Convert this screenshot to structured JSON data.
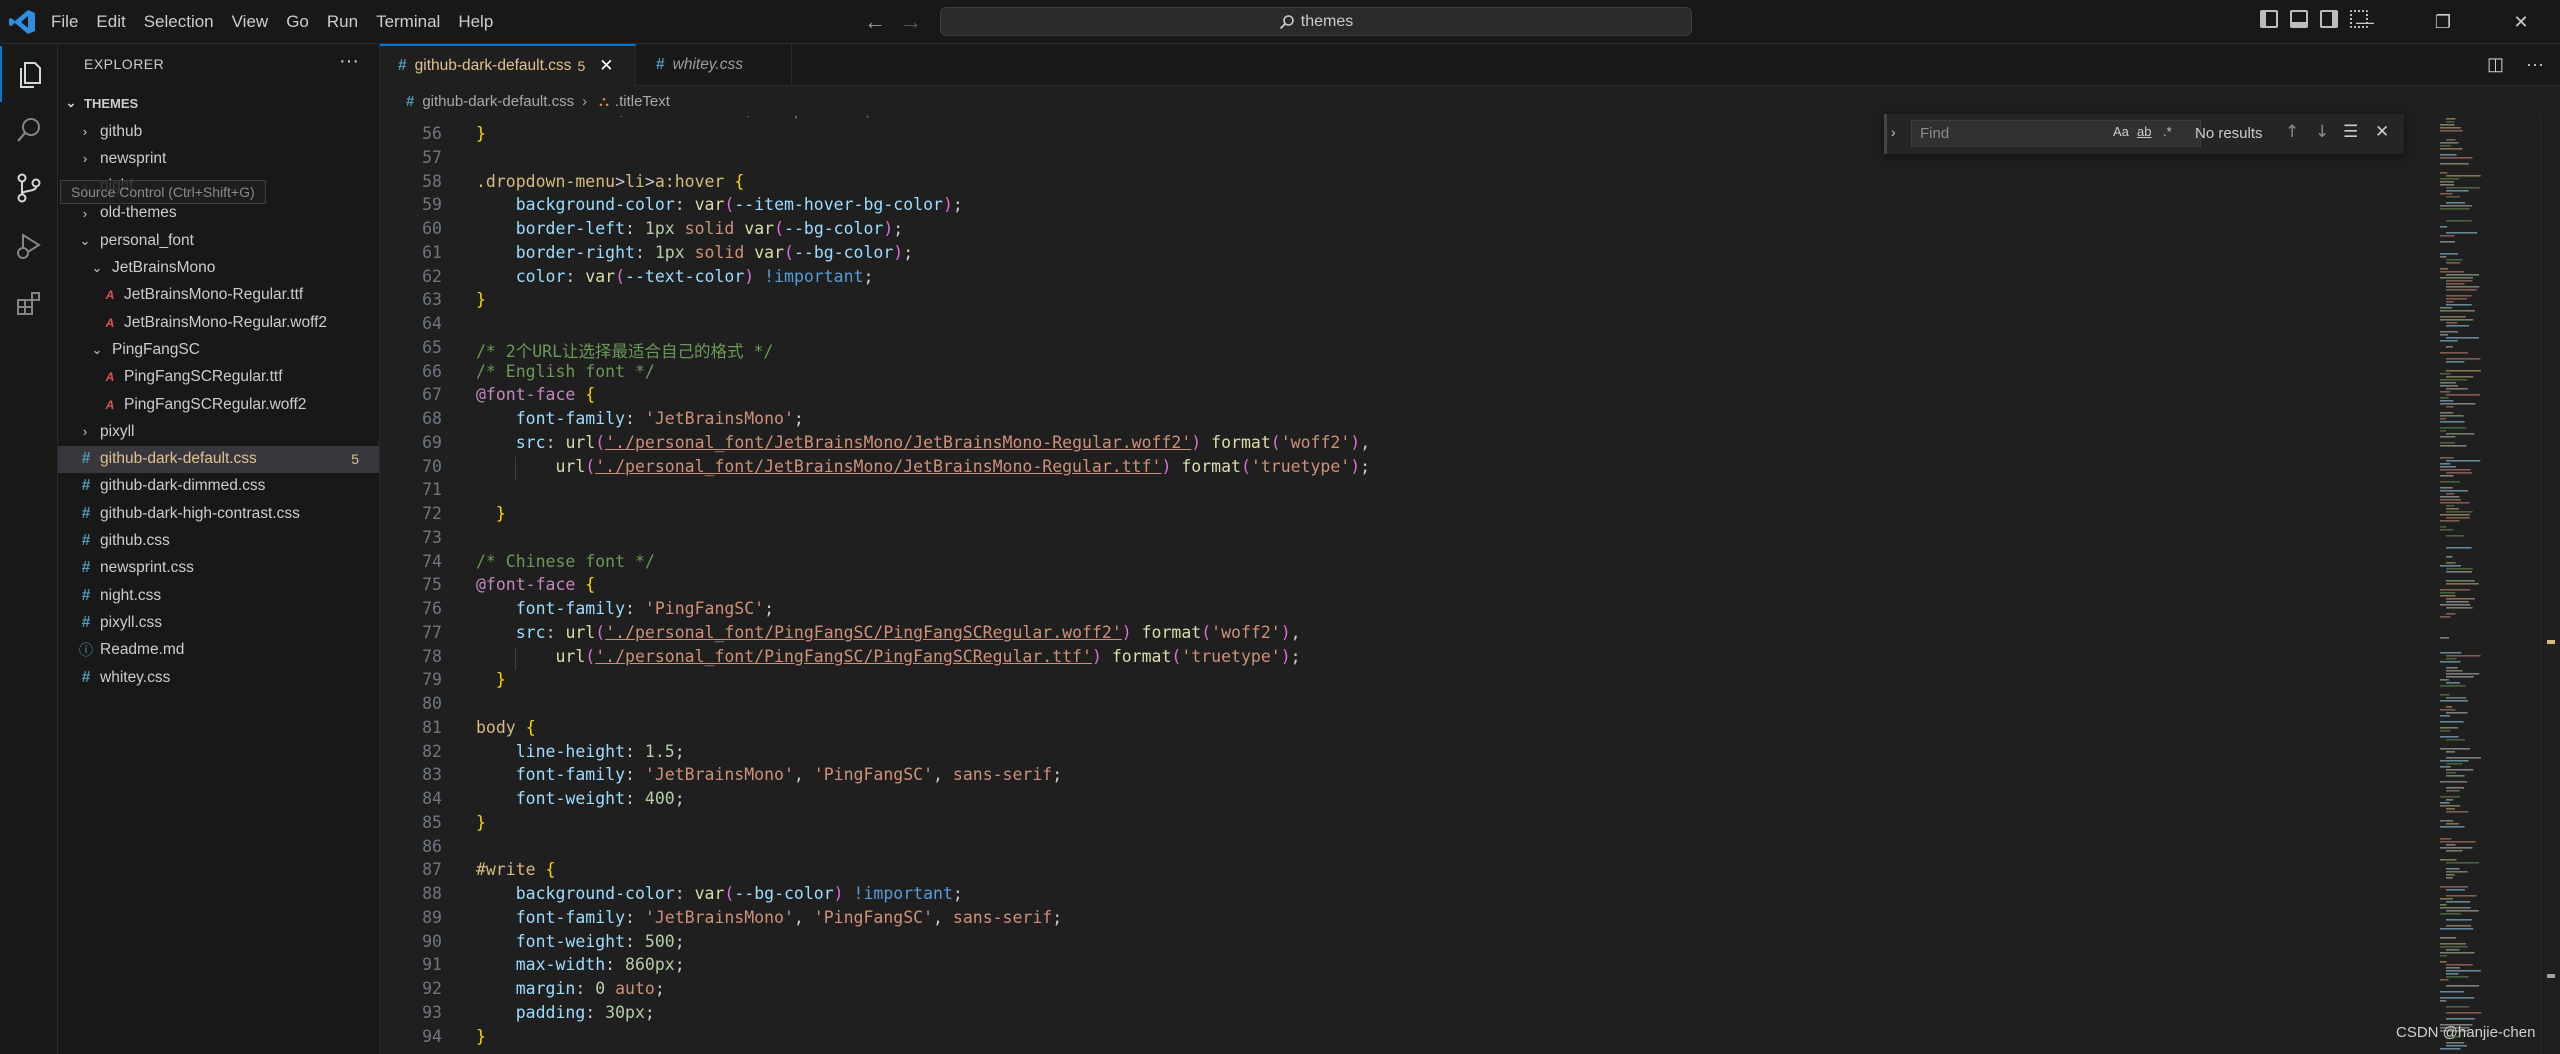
{
  "menu": [
    "File",
    "Edit",
    "Selection",
    "View",
    "Go",
    "Run",
    "Terminal",
    "Help"
  ],
  "search": {
    "text": "themes"
  },
  "explorer": {
    "title": "EXPLORER",
    "section": "THEMES",
    "tooltip": "Source Control (Ctrl+Shift+G)",
    "items": [
      {
        "label": "github",
        "type": "folder",
        "depth": 0,
        "open": false
      },
      {
        "label": "newsprint",
        "type": "folder",
        "depth": 0,
        "open": false
      },
      {
        "label": "night",
        "type": "folder",
        "depth": 0,
        "open": false
      },
      {
        "label": "old-themes",
        "type": "folder",
        "depth": 0,
        "open": false
      },
      {
        "label": "personal_font",
        "type": "folder",
        "depth": 0,
        "open": true
      },
      {
        "label": "JetBrainsMono",
        "type": "folder",
        "depth": 1,
        "open": true
      },
      {
        "label": "JetBrainsMono-Regular.ttf",
        "type": "font",
        "depth": 2
      },
      {
        "label": "JetBrainsMono-Regular.woff2",
        "type": "font",
        "depth": 2
      },
      {
        "label": "PingFangSC",
        "type": "folder",
        "depth": 1,
        "open": true
      },
      {
        "label": "PingFangSCRegular.ttf",
        "type": "font",
        "depth": 2
      },
      {
        "label": "PingFangSCRegular.woff2",
        "type": "font",
        "depth": 2
      },
      {
        "label": "pixyll",
        "type": "folder",
        "depth": 0,
        "open": false
      },
      {
        "label": "github-dark-default.css",
        "type": "css",
        "depth": 0,
        "selected": true,
        "badge": "5"
      },
      {
        "label": "github-dark-dimmed.css",
        "type": "css",
        "depth": 0
      },
      {
        "label": "github-dark-high-contrast.css",
        "type": "css",
        "depth": 0
      },
      {
        "label": "github.css",
        "type": "css",
        "depth": 0
      },
      {
        "label": "newsprint.css",
        "type": "css",
        "depth": 0
      },
      {
        "label": "night.css",
        "type": "css",
        "depth": 0
      },
      {
        "label": "pixyll.css",
        "type": "css",
        "depth": 0
      },
      {
        "label": "Readme.md",
        "type": "md",
        "depth": 0
      },
      {
        "label": "whitey.css",
        "type": "css",
        "depth": 0
      }
    ]
  },
  "tabs": [
    {
      "label": "github-dark-default.css",
      "badge": "5",
      "close": "✕"
    },
    {
      "label": "whitey.css"
    }
  ],
  "breadcrumb": {
    "file": "github-dark-default.css",
    "symbol": ".titleText"
  },
  "find": {
    "placeholder": "Find",
    "result": "No results",
    "opt_case": "Aa",
    "opt_word": "ab",
    "opt_regex": ".*"
  },
  "code_lines": [
    {
      "n": "56",
      "html": "<span class=\"br\">}</span>"
    },
    {
      "n": "57",
      "html": ""
    },
    {
      "n": "58",
      "html": "<span class=\"k\">.dropdown-menu</span>&gt;<span class=\"k\">li</span>&gt;<span class=\"k\">a:hover</span> <span class=\"br\">{</span>"
    },
    {
      "n": "59",
      "html": "    <span class=\"p\">background-color</span>: <span class=\"fn\">var</span><span class=\"br2\">(</span><span class=\"p\">--item-hover-bg-color</span><span class=\"br2\">)</span>;"
    },
    {
      "n": "60",
      "html": "    <span class=\"p\">border-left</span>: <span class=\"n\">1px</span> <span class=\"s\">solid</span> <span class=\"fn\">var</span><span class=\"br2\">(</span><span class=\"p\">--bg-color</span><span class=\"br2\">)</span>;"
    },
    {
      "n": "61",
      "html": "    <span class=\"p\">border-right</span>: <span class=\"n\">1px</span> <span class=\"s\">solid</span> <span class=\"fn\">var</span><span class=\"br2\">(</span><span class=\"p\">--bg-color</span><span class=\"br2\">)</span>;"
    },
    {
      "n": "62",
      "html": "    <span class=\"p\">color</span>: <span class=\"fn\">var</span><span class=\"br2\">(</span><span class=\"p\">--text-color</span><span class=\"br2\">)</span> <span class=\"imp\">!important</span>;"
    },
    {
      "n": "63",
      "html": "<span class=\"br\">}</span>"
    },
    {
      "n": "64",
      "html": ""
    },
    {
      "n": "65",
      "html": "<span class=\"c\">/* 2个URL让选择最适合自己的格式 */</span>"
    },
    {
      "n": "66",
      "html": "<span class=\"c\">/* English font */</span>"
    },
    {
      "n": "67",
      "html": "<span class=\"at\">@font-face</span> <span class=\"br\">{</span>"
    },
    {
      "n": "68",
      "html": "    <span class=\"p\">font-family</span>: <span class=\"s\">'JetBrainsMono'</span>;"
    },
    {
      "n": "69",
      "html": "    <span class=\"p\">src</span>: <span class=\"fn\">url</span><span class=\"br2\">(</span><span class=\"s u\">'./personal_font/JetBrainsMono/JetBrainsMono-Regular.woff2'</span><span class=\"br2\">)</span> <span class=\"fn\">format</span><span class=\"br2\">(</span><span class=\"s\">'woff2'</span><span class=\"br2\">)</span>,"
    },
    {
      "n": "70",
      "html": "        <span class=\"fn\">url</span><span class=\"br2\">(</span><span class=\"s u\">'./personal_font/JetBrainsMono/JetBrainsMono-Regular.ttf'</span><span class=\"br2\">)</span> <span class=\"fn\">format</span><span class=\"br2\">(</span><span class=\"s\">'truetype'</span><span class=\"br2\">)</span>;"
    },
    {
      "n": "71",
      "html": ""
    },
    {
      "n": "72",
      "html": "  <span class=\"br\">}</span>"
    },
    {
      "n": "73",
      "html": ""
    },
    {
      "n": "74",
      "html": "<span class=\"c\">/* Chinese font */</span>"
    },
    {
      "n": "75",
      "html": "<span class=\"at\">@font-face</span> <span class=\"br\">{</span>"
    },
    {
      "n": "76",
      "html": "    <span class=\"p\">font-family</span>: <span class=\"s\">'PingFangSC'</span>;"
    },
    {
      "n": "77",
      "html": "    <span class=\"p\">src</span>: <span class=\"fn\">url</span><span class=\"br2\">(</span><span class=\"s u\">'./personal_font/PingFangSC/PingFangSCRegular.woff2'</span><span class=\"br2\">)</span> <span class=\"fn\">format</span><span class=\"br2\">(</span><span class=\"s\">'woff2'</span><span class=\"br2\">)</span>,"
    },
    {
      "n": "78",
      "html": "        <span class=\"fn\">url</span><span class=\"br2\">(</span><span class=\"s u\">'./personal_font/PingFangSC/PingFangSCRegular.ttf'</span><span class=\"br2\">)</span> <span class=\"fn\">format</span><span class=\"br2\">(</span><span class=\"s\">'truetype'</span><span class=\"br2\">)</span>;"
    },
    {
      "n": "79",
      "html": "  <span class=\"br\">}</span>"
    },
    {
      "n": "80",
      "html": ""
    },
    {
      "n": "81",
      "html": "<span class=\"k\">body</span> <span class=\"br\">{</span>"
    },
    {
      "n": "82",
      "html": "    <span class=\"p\">line-height</span>: <span class=\"n\">1.5</span>;"
    },
    {
      "n": "83",
      "html": "    <span class=\"p\">font-family</span>: <span class=\"s\">'JetBrainsMono'</span>, <span class=\"s\">'PingFangSC'</span>, <span class=\"s\">sans-serif</span>;"
    },
    {
      "n": "84",
      "html": "    <span class=\"p\">font-weight</span>: <span class=\"n\">400</span>;"
    },
    {
      "n": "85",
      "html": "<span class=\"br\">}</span>"
    },
    {
      "n": "86",
      "html": ""
    },
    {
      "n": "87",
      "html": "<span class=\"k\">#write</span> <span class=\"br\">{</span>"
    },
    {
      "n": "88",
      "html": "    <span class=\"p\">background-color</span>: <span class=\"fn\">var</span><span class=\"br2\">(</span><span class=\"p\">--bg-color</span><span class=\"br2\">)</span> <span class=\"imp\">!important</span>;"
    },
    {
      "n": "89",
      "html": "    <span class=\"p\">font-family</span>: <span class=\"s\">'JetBrainsMono'</span>, <span class=\"s\">'PingFangSC'</span>, <span class=\"s\">sans-serif</span>;"
    },
    {
      "n": "90",
      "html": "    <span class=\"p\">font-weight</span>: <span class=\"n\">500</span>;"
    },
    {
      "n": "91",
      "html": "    <span class=\"p\">max-width</span>: <span class=\"n\">860px</span>;"
    },
    {
      "n": "92",
      "html": "    <span class=\"p\">margin</span>: <span class=\"n\">0</span> <span class=\"s\">auto</span>;"
    },
    {
      "n": "93",
      "html": "    <span class=\"p\">padding</span>: <span class=\"n\">30px</span>;"
    },
    {
      "n": "94",
      "html": "<span class=\"br\">}</span>"
    }
  ],
  "watermark": "CSDN @hanjie-chen",
  "colors": {
    "accent": "#0078d4",
    "modified": "#e2c08d",
    "css_icon": "#519aba",
    "font_icon": "#e05252"
  }
}
